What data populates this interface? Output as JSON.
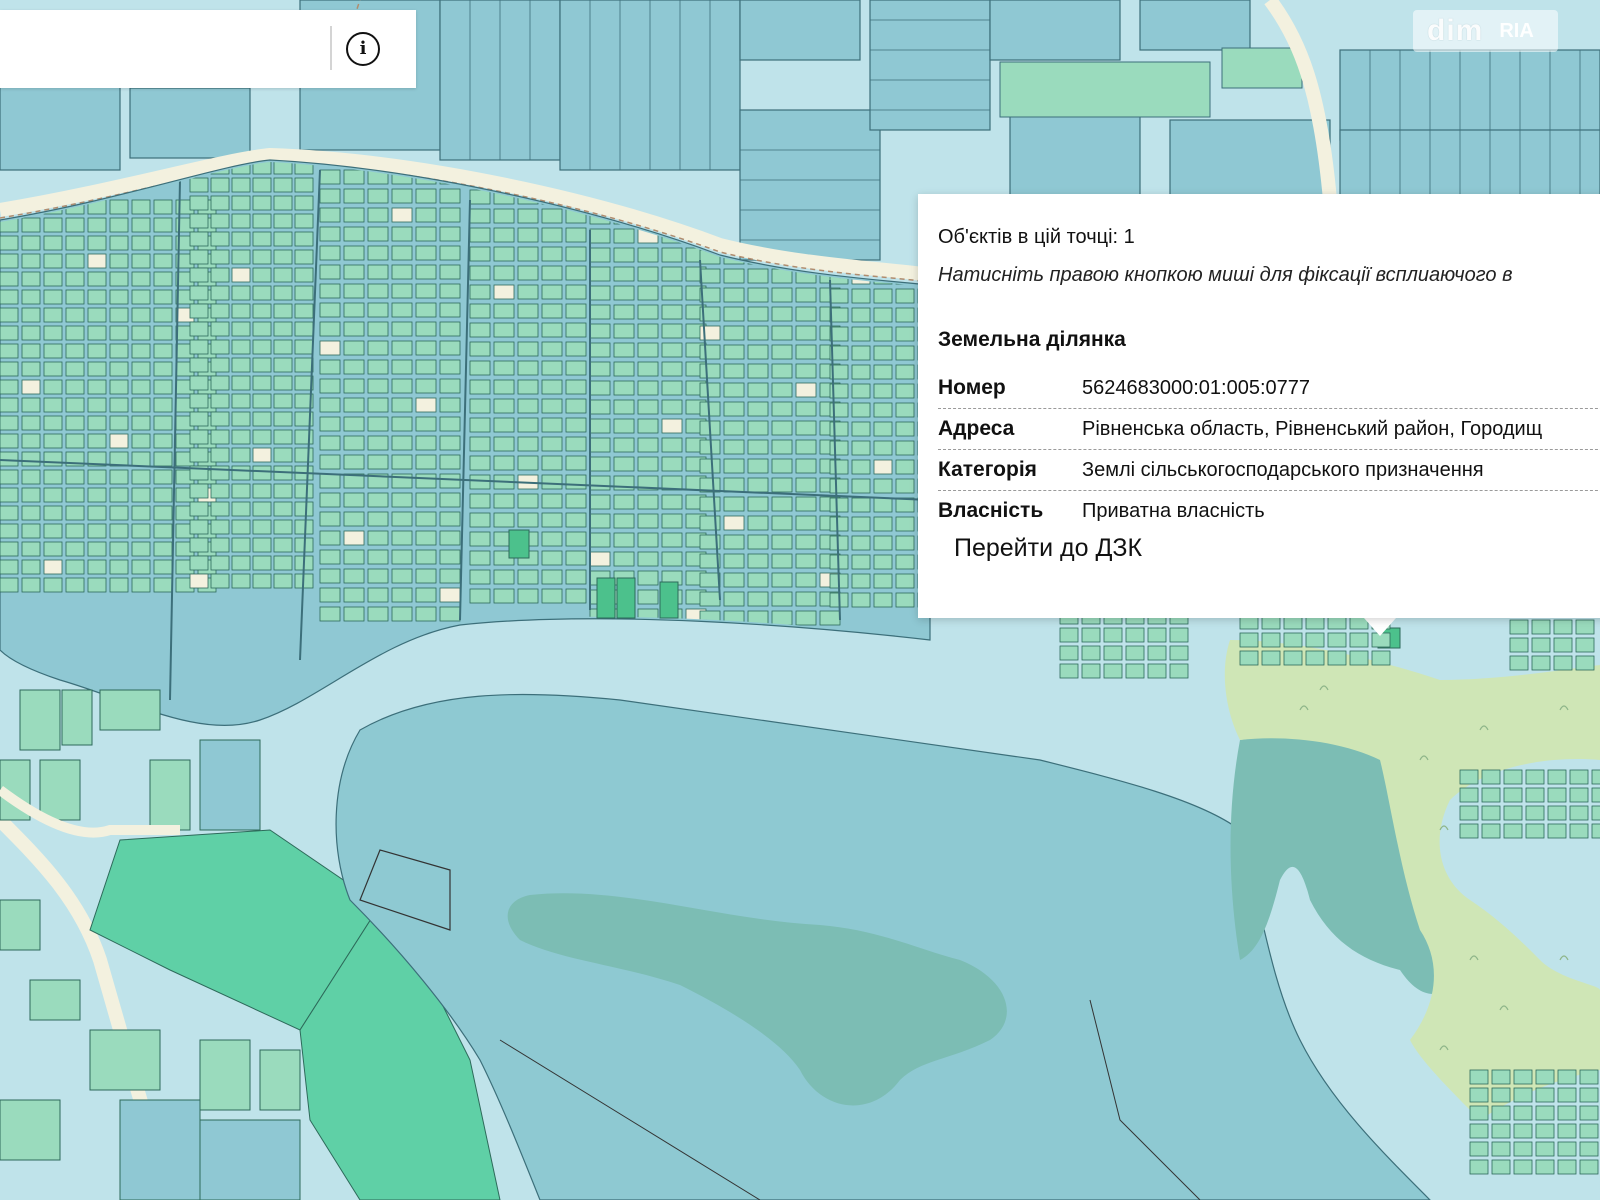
{
  "search": {
    "placeholder": ""
  },
  "info_button": {
    "symbol": "i"
  },
  "watermark": {
    "text": "dim",
    "logo": "RIA"
  },
  "map": {
    "colors": {
      "water": "#bfe3ea",
      "parcel_blue": "#8fc8d3",
      "parcel_green": "#9adbbd",
      "parcel_highlight": "#4cc18c",
      "forest": "#cfe6b6",
      "wetland": "#7cbdb4",
      "road": "#f3f1df",
      "lake": "#8ec9d2"
    }
  },
  "popup": {
    "objects_count": "Об'єктів в цій точці: 1",
    "hint": "Натисніть правою кнопкою миші для фіксації всплиаючого в",
    "heading": "Земельна ділянка",
    "rows": [
      {
        "key": "Номер",
        "value": "5624683000:01:005:0777"
      },
      {
        "key": "Адреса",
        "value": "Рівненська область, Рівненський район, Городищ"
      },
      {
        "key": "Категорія",
        "value": "Землі сільськогосподарського призначення"
      },
      {
        "key": "Власність",
        "value": "Приватна власність"
      }
    ],
    "link_label": "Перейти до ДЗК"
  }
}
